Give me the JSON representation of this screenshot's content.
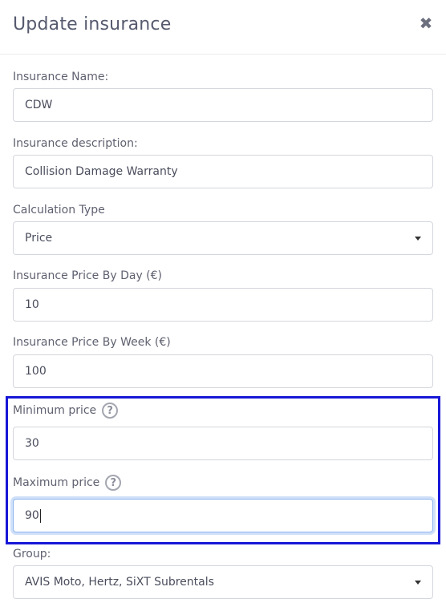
{
  "modal": {
    "title": "Update insurance",
    "close_icon": "close-icon"
  },
  "form": {
    "name": {
      "label": "Insurance Name:",
      "value": "CDW"
    },
    "description": {
      "label": "Insurance description:",
      "value": "Collision Damage Warranty"
    },
    "calculation_type": {
      "label": "Calculation Type",
      "value": "Price"
    },
    "price_day": {
      "label": "Insurance Price By Day (€)",
      "value": "10"
    },
    "price_week": {
      "label": "Insurance Price By Week (€)",
      "value": "100"
    },
    "min_price": {
      "label": "Minimum price",
      "value": "30",
      "help_icon": "question-circle-icon"
    },
    "max_price": {
      "label": "Maximum price",
      "value": "90",
      "help_icon": "question-circle-icon"
    },
    "group": {
      "label": "Group:",
      "value": "AVIS Moto, Hertz, SiXT Subrentals"
    }
  },
  "colors": {
    "highlight_border": "#1717d6",
    "focus_border": "#8fb6f0"
  }
}
